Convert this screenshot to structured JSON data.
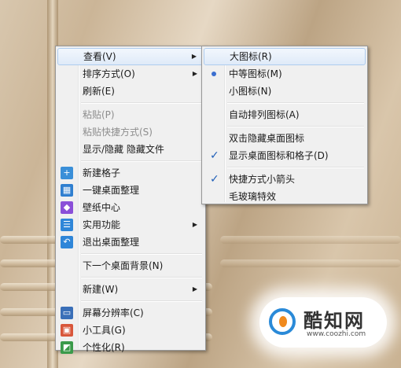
{
  "main_menu": [
    {
      "label": "查看(V)",
      "type": "submenu",
      "highlight": true
    },
    {
      "label": "排序方式(O)",
      "type": "submenu"
    },
    {
      "label": "刷新(E)",
      "type": "item"
    },
    {
      "type": "separator"
    },
    {
      "label": "粘贴(P)",
      "type": "disabled"
    },
    {
      "label": "粘贴快捷方式(S)",
      "type": "disabled"
    },
    {
      "label": "显示/隐藏 隐藏文件",
      "type": "item"
    },
    {
      "type": "separator"
    },
    {
      "label": "新建格子",
      "type": "item",
      "icon": "plus-icon",
      "color": "#3a8fd8"
    },
    {
      "label": "一键桌面整理",
      "type": "item",
      "icon": "layout-icon",
      "color": "#2f7fd0"
    },
    {
      "label": "壁纸中心",
      "type": "item",
      "icon": "cube-icon",
      "color": "#8a4fd8"
    },
    {
      "label": "实用功能",
      "type": "submenu",
      "icon": "list-icon",
      "color": "#2f86d8"
    },
    {
      "label": "退出桌面整理",
      "type": "item",
      "icon": "undo-icon",
      "color": "#2f86d8"
    },
    {
      "type": "separator"
    },
    {
      "label": "下一个桌面背景(N)",
      "type": "item"
    },
    {
      "type": "separator"
    },
    {
      "label": "新建(W)",
      "type": "submenu"
    },
    {
      "type": "separator"
    },
    {
      "label": "屏幕分辨率(C)",
      "type": "item",
      "icon": "monitor-icon",
      "color": "#3a6fb8"
    },
    {
      "label": "小工具(G)",
      "type": "item",
      "icon": "gadgets-icon",
      "color": "#d8563a"
    },
    {
      "label": "个性化(R)",
      "type": "item",
      "icon": "personalize-icon",
      "color": "#3a9a4a"
    }
  ],
  "sub_menu": [
    {
      "label": "大图标(R)",
      "type": "item",
      "highlight": true
    },
    {
      "label": "中等图标(M)",
      "type": "radio"
    },
    {
      "label": "小图标(N)",
      "type": "item"
    },
    {
      "type": "separator"
    },
    {
      "label": "自动排列图标(A)",
      "type": "item"
    },
    {
      "type": "separator"
    },
    {
      "label": "双击隐藏桌面图标",
      "type": "item"
    },
    {
      "label": "显示桌面图标和格子(D)",
      "type": "check"
    },
    {
      "type": "separator"
    },
    {
      "label": "快捷方式小箭头",
      "type": "check"
    },
    {
      "label": "毛玻璃特效",
      "type": "item"
    }
  ],
  "watermark": {
    "title": "酷知网",
    "url": "www.coozhi.com"
  }
}
